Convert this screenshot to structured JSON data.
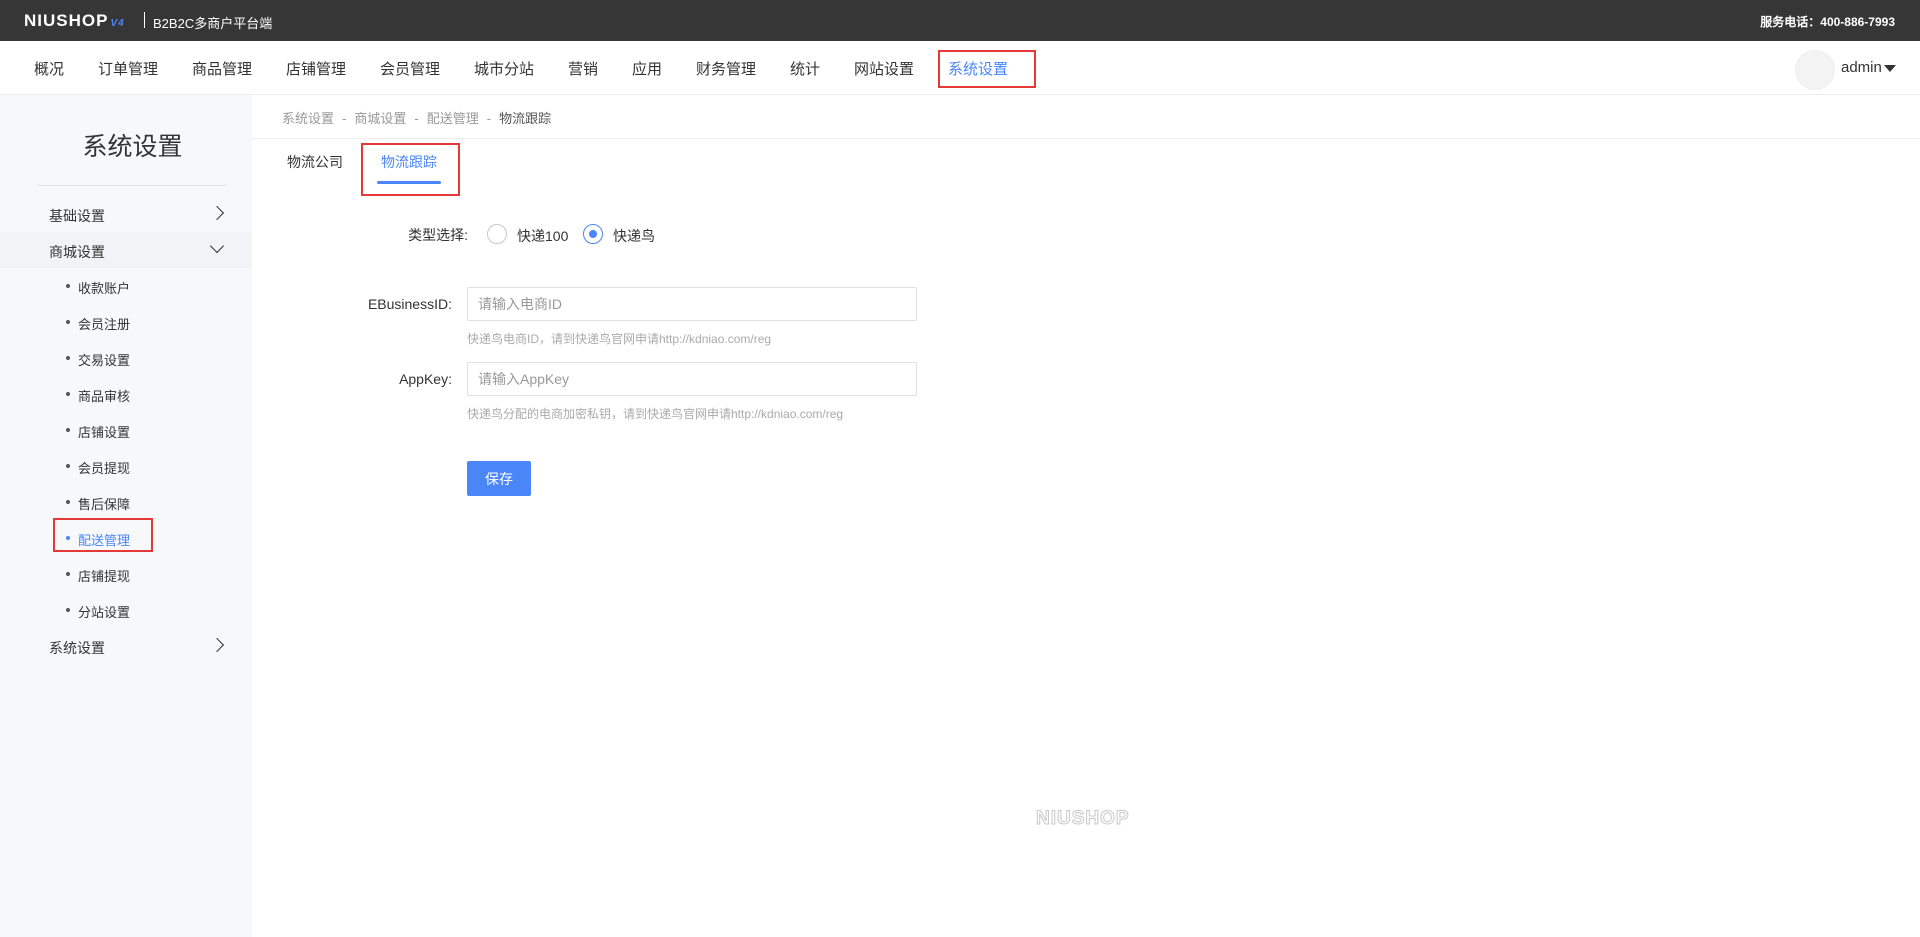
{
  "topbar": {
    "logo": "NIUSHOP",
    "logo_version": "V4",
    "subtitle": "B2B2C多商户平台端",
    "service_phone": "服务电话：400-886-7993"
  },
  "mainnav": {
    "items": [
      "概况",
      "订单管理",
      "商品管理",
      "店铺管理",
      "会员管理",
      "城市分站",
      "营销",
      "应用",
      "财务管理",
      "统计",
      "网站设置",
      "系统设置"
    ],
    "active_index": 11,
    "user": "admin"
  },
  "sidebar": {
    "title": "系统设置",
    "groups": [
      {
        "label": "基础设置",
        "open": false
      },
      {
        "label": "商城设置",
        "open": true
      },
      {
        "label": "系统设置",
        "open": false
      }
    ],
    "sub_items": [
      "收款账户",
      "会员注册",
      "交易设置",
      "商品审核",
      "店铺设置",
      "会员提现",
      "售后保障",
      "配送管理",
      "店铺提现",
      "分站设置"
    ],
    "active_sub": "配送管理"
  },
  "breadcrumb": {
    "items": [
      "系统设置",
      "商城设置",
      "配送管理",
      "物流跟踪"
    ],
    "separator": "-"
  },
  "tabs": [
    "物流公司",
    "物流跟踪"
  ],
  "active_tab": "物流跟踪",
  "form": {
    "type_label": "类型选择:",
    "options": [
      "快递100",
      "快递鸟"
    ],
    "selected_option": "快递鸟",
    "ebusiness_label": "EBusinessID:",
    "ebusiness_placeholder": "请输入电商ID",
    "ebusiness_value": "",
    "ebusiness_hint": "快递鸟电商ID，请到快递鸟官网申请http://kdniao.com/reg",
    "appkey_label": "AppKey:",
    "appkey_placeholder": "请输入AppKey",
    "appkey_value": "",
    "appkey_hint": "快递鸟分配的电商加密私钥，请到快递鸟官网申请http://kdniao.com/reg",
    "save_label": "保存"
  },
  "footer": {
    "logo": "NIUSHOP"
  },
  "colors": {
    "accent": "#4a86f7",
    "topbar_bg": "#363636",
    "sidebar_bg": "#f7f8fa",
    "highlight_box": "#e53935"
  }
}
